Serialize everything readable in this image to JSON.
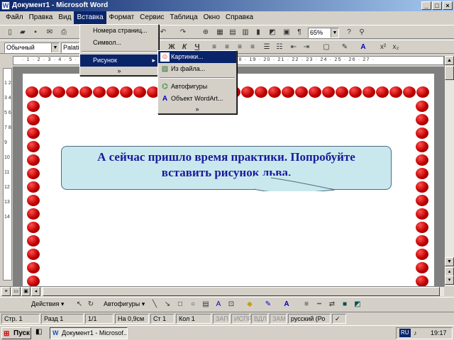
{
  "window": {
    "title": "Документ1 - Microsoft Word",
    "minimize": "_",
    "maximize": "□",
    "close": "×"
  },
  "menubar": {
    "items": [
      "Файл",
      "Правка",
      "Вид",
      "Вставка",
      "Формат",
      "Сервис",
      "Таблица",
      "Окно",
      "Справка"
    ],
    "selected": 3
  },
  "toolbar1": {
    "zoom": "65%"
  },
  "toolbar2": {
    "style": "Обычный",
    "font": "Palatino",
    "bold": "Ж",
    "italic": "К",
    "underline": "Ч"
  },
  "insert_menu": {
    "items": [
      "Номера страниц...",
      "Символ...",
      "Рисунок"
    ],
    "more": "»"
  },
  "picture_submenu": {
    "items": [
      "Картинки...",
      "Из файла...",
      "Автофигуры",
      "Объект WordArt..."
    ],
    "more": "»"
  },
  "ruler": {
    "marks": "· 1 · 2 · 3 · 4 · 5 · 6 · 7 · 8 · 9 · 10 · 11 · 12 · 13 · 14 · 15 · 16 · 17 · 18 · 19 · 20 · 21 · 22 · 23 · 24 · 25 · 26 · 27 ·"
  },
  "vruler": {
    "marks": "1 2 3 4 5 6 7 8 9 10 11 12 13 14"
  },
  "callout": {
    "line1": "А сейчас пришло время практики. Попробуйте",
    "line2": "вставить рисунок льва."
  },
  "drawbar": {
    "actions": "Действия ▾",
    "autoshapes": "Автофигуры ▾"
  },
  "statusbar": {
    "page": "Стр. 1",
    "section": "Разд 1",
    "pages": "1/1",
    "at": "На 0,9см",
    "line": "Ст 1",
    "col": "Кол 1",
    "rec": "ЗАП",
    "trk": "ИСПР",
    "ext": "ВДЛ",
    "ovr": "ЗАМ",
    "lang": "русский (Ро"
  },
  "taskbar": {
    "start": "Пуск",
    "task": "Документ1 - Microsof...",
    "lang": "RU",
    "time": "19:17"
  }
}
